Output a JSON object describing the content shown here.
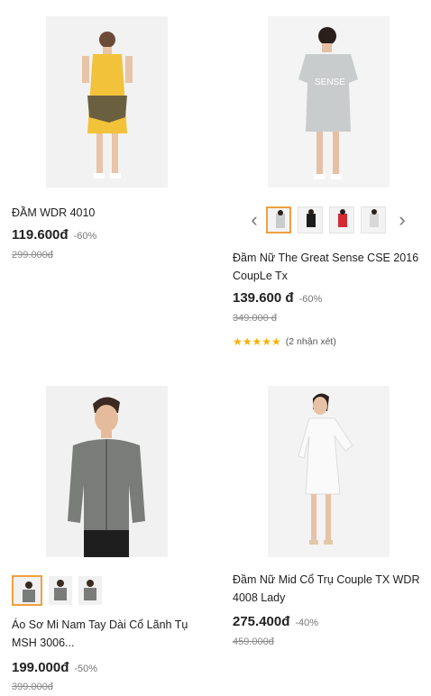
{
  "products": [
    {
      "name": "ĐẦM WDR 4010",
      "price": "119.600đ",
      "discount": "-60%",
      "old_price": "299.000đ"
    },
    {
      "name": "Đầm Nữ The Great Sense CSE 2016 CoupLe Tx",
      "price": "139.600 đ",
      "discount": "-60%",
      "old_price": "349.000 đ",
      "print_text": "SENSE",
      "rating_count": "(2 nhận xét)",
      "stars": "★★★★★",
      "prev_arrow": "‹",
      "next_arrow": "›"
    },
    {
      "name": "Áo Sơ Mi Nam Tay Dài Cổ Lãnh Tụ MSH 3006...",
      "price": "199.000đ",
      "discount": "-50%",
      "old_price": "399.000đ"
    },
    {
      "name": "Đầm Nữ Mid Cổ Trụ Couple TX WDR 4008 Lady",
      "price": "275.400đ",
      "discount": "-40%",
      "old_price": "459.000đ"
    }
  ]
}
